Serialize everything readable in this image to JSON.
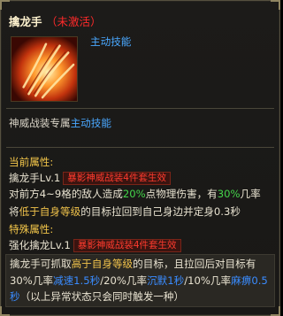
{
  "skill": {
    "name": "擒龙手",
    "status": "（未激活）",
    "type_label": "主动技能",
    "icon": "dragon-claw-skill-icon"
  },
  "extension": {
    "prefix": "神威战装专属",
    "type": "主动技能"
  },
  "current": {
    "header": "当前属性:",
    "level": "擒龙手Lv.1",
    "badge": "暴影神威战装4件套生效",
    "line1": {
      "a": "对前方4~9格的敌人造成",
      "pct": "20%",
      "b": "点物理伤害，有",
      "chance": "30%",
      "c": "几率"
    },
    "line2": {
      "a": "将",
      "cond": "低于自身等级",
      "b": "的目标拉回到自己身边并定身0.3秒"
    }
  },
  "special": {
    "header": "特殊属性:",
    "level": "强化擒龙Lv.1",
    "badge": "暴影神威战装4件套生效",
    "line1": {
      "a": "擒龙手可抓取",
      "cond": "高于自身等级",
      "b": "的目标，且拉回后对目标有"
    },
    "line2": {
      "p1": "30%几率",
      "e1": "减速1.5秒",
      "s1": "/",
      "p2": "20%几率",
      "e2": "沉默1秒",
      "s2": "/",
      "p3": "10%几率",
      "e3": "麻痹0.5"
    },
    "line3": {
      "a": "秒",
      "b": "（以上异常状态只会同时触发一种）"
    }
  },
  "colors": {
    "status": "#ff2a2a",
    "skill_type": "#4aa8ff",
    "section": "#f3c64a",
    "badge": "#ff3b2e",
    "percent": "#44d44a",
    "condition": "#f0c24b",
    "effect": "#3a8cff"
  }
}
